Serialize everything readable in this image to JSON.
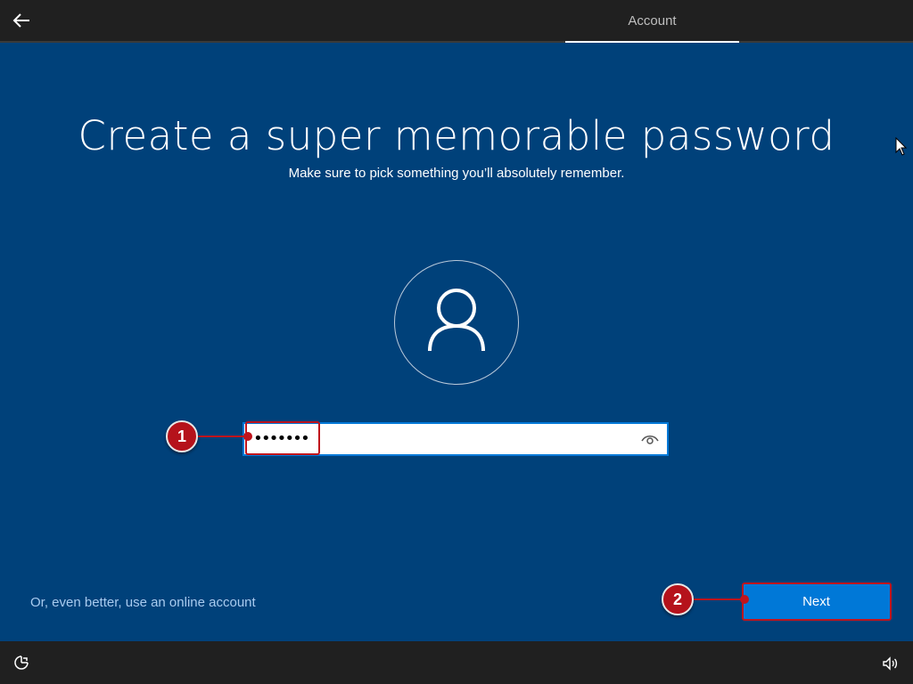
{
  "header": {
    "back_icon": "arrow-left-icon",
    "tab_label": "Account"
  },
  "main": {
    "title": "Create a super memorable password",
    "subtitle": "Make sure to pick something you’ll absolutely remember.",
    "avatar_icon": "user-icon",
    "password": {
      "value": "•••••••",
      "reveal_icon": "eye-icon"
    },
    "online_account_link": "Or, even better, use an online account",
    "next_label": "Next"
  },
  "callouts": [
    {
      "number": "1"
    },
    {
      "number": "2"
    }
  ],
  "footer": {
    "ease_of_access_icon": "ease-of-access-icon",
    "volume_icon": "volume-icon"
  },
  "colors": {
    "background": "#00417a",
    "bar": "#202020",
    "accent": "#0078d7",
    "callout": "#c0141c",
    "link": "#a9cbef"
  }
}
